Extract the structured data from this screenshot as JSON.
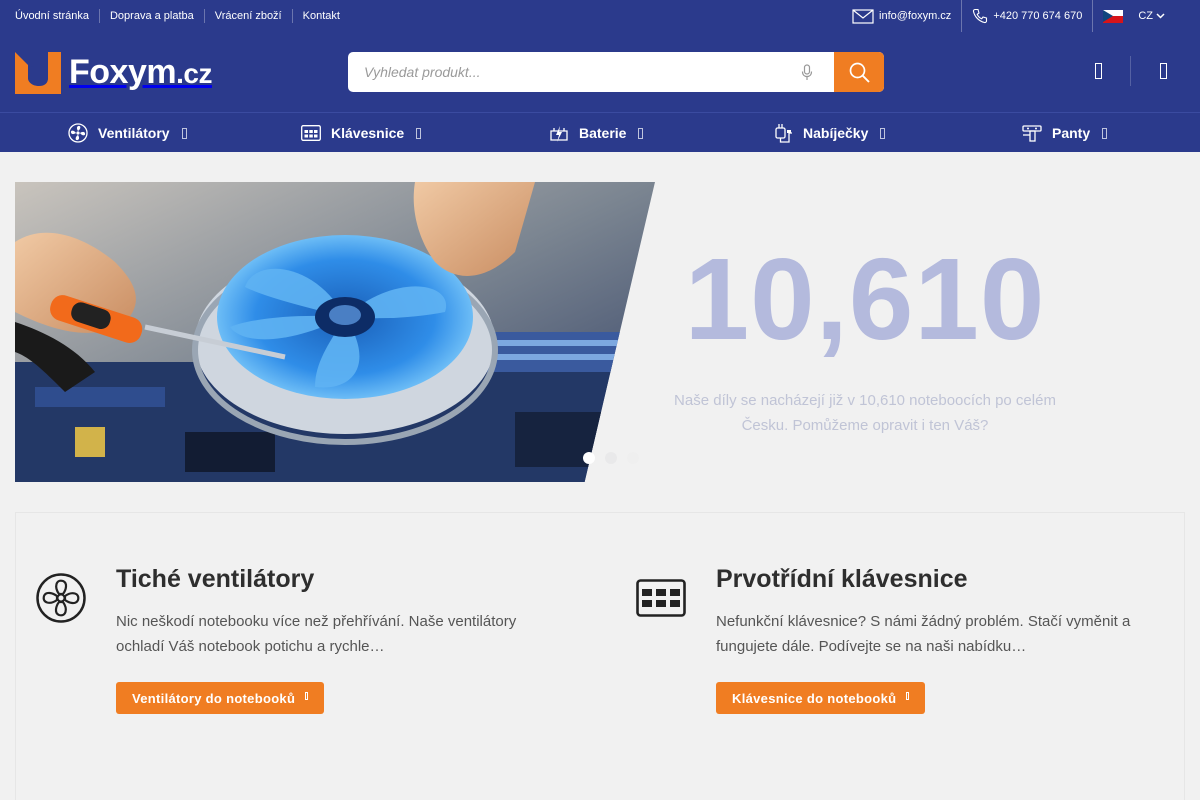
{
  "colors": {
    "primary": "#2b3a8c",
    "accent": "#f07d22",
    "hero_number": "#b4badd"
  },
  "topbar": {
    "links": [
      {
        "label": "Úvodní stránka"
      },
      {
        "label": "Doprava a platba"
      },
      {
        "label": "Vrácení zboží"
      },
      {
        "label": "Kontakt"
      }
    ],
    "email": "info@foxym.cz",
    "phone": "+420 770 674 670",
    "language": "CZ",
    "icons": [
      "envelope-icon",
      "phone-icon",
      "czech-flag-icon",
      "chevron-down-icon"
    ]
  },
  "header": {
    "logo": {
      "name": "Foxym",
      "tld": ".cz"
    },
    "search": {
      "placeholder": "Vyhledat produkt...",
      "value": ""
    },
    "icons": [
      "microphone-icon",
      "search-icon",
      "account-icon",
      "cart-icon"
    ]
  },
  "nav": {
    "items": [
      {
        "label": "Ventilátory",
        "icon": "fan-icon"
      },
      {
        "label": "Klávesnice",
        "icon": "keyboard-icon"
      },
      {
        "label": "Baterie",
        "icon": "battery-icon"
      },
      {
        "label": "Nabíječky",
        "icon": "charger-icon"
      },
      {
        "label": "Panty",
        "icon": "hinge-icon"
      }
    ]
  },
  "hero": {
    "number": "10,610",
    "text": "Naše díly se nacházejí již v 10,610 noteboocích po celém Česku. Pomůžeme opravit i ten Váš?",
    "slides": 3,
    "active_slide": 1
  },
  "features": [
    {
      "icon": "fan-icon",
      "title": "Tiché ventilátory",
      "description": "Nic neškodí notebooku více než přehřívání. Naše ventilátory ochladí Váš notebook potichu a rychle…",
      "button": "Ventilátory do notebooků"
    },
    {
      "icon": "keyboard-icon",
      "title": "Prvotřídní klávesnice",
      "description": "Nefunkční klávesnice? S námi žádný problém. Stačí vyměnit a fungujete dále. Podívejte se na naši nabídku…",
      "button": "Klávesnice do notebooků"
    }
  ]
}
